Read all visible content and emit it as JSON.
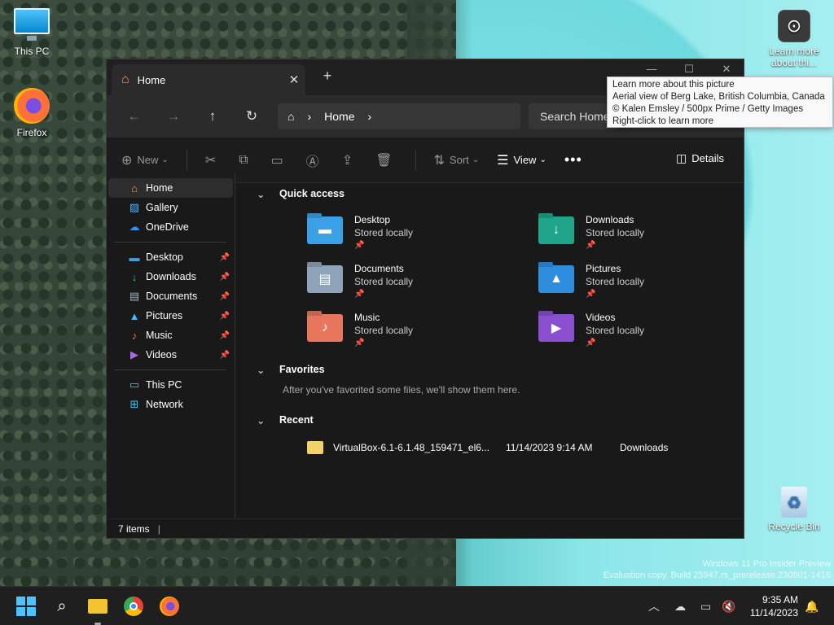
{
  "desktop": {
    "icons": [
      {
        "label": "This PC"
      },
      {
        "label": "Firefox"
      },
      {
        "label": "Recycle Bin"
      },
      {
        "label": "Learn more about thi..."
      }
    ],
    "tooltip": {
      "line1": "Learn more about this picture",
      "line2": "Aerial view of Berg Lake, British Columbia, Canada",
      "line3": "© Kalen Emsley / 500px Prime / Getty Images",
      "line4": "Right-click to learn more"
    },
    "watermark": {
      "line1": "Windows 11 Pro Insider Preview",
      "line2": "Evaluation copy. Build 25947.rs_prerelease.230901-1416"
    }
  },
  "window": {
    "tab_title": "Home",
    "address": {
      "crumb": "Home"
    },
    "search_placeholder": "Search Home",
    "commands": {
      "new": "New",
      "sort": "Sort",
      "view": "View",
      "details": "Details"
    },
    "sidebar": {
      "top": [
        {
          "label": "Home"
        },
        {
          "label": "Gallery"
        },
        {
          "label": "OneDrive"
        }
      ],
      "pinned": [
        {
          "label": "Desktop"
        },
        {
          "label": "Downloads"
        },
        {
          "label": "Documents"
        },
        {
          "label": "Pictures"
        },
        {
          "label": "Music"
        },
        {
          "label": "Videos"
        }
      ],
      "bottom": [
        {
          "label": "This PC"
        },
        {
          "label": "Network"
        }
      ]
    },
    "sections": {
      "quick_access": "Quick access",
      "favorites": "Favorites",
      "favorites_empty": "After you've favorited some files, we'll show them here.",
      "recent": "Recent"
    },
    "quick_access": [
      {
        "name": "Desktop",
        "status": "Stored locally",
        "color": "#3aa0e8"
      },
      {
        "name": "Downloads",
        "status": "Stored locally",
        "color": "#1fa58a"
      },
      {
        "name": "Documents",
        "status": "Stored locally",
        "color": "#8fa3b8"
      },
      {
        "name": "Pictures",
        "status": "Stored locally",
        "color": "#2d8ee0"
      },
      {
        "name": "Music",
        "status": "Stored locally",
        "color": "#e8765c"
      },
      {
        "name": "Videos",
        "status": "Stored locally",
        "color": "#8a4fd0"
      }
    ],
    "recent": [
      {
        "name": "VirtualBox-6.1-6.1.48_159471_el6...",
        "date": "11/14/2023 9:14 AM",
        "location": "Downloads"
      }
    ],
    "status": "7 items"
  },
  "taskbar": {
    "time": "9:35 AM",
    "date": "11/14/2023"
  }
}
